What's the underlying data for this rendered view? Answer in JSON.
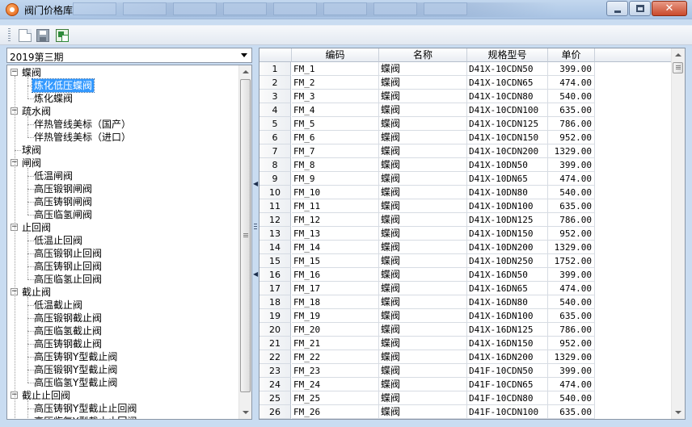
{
  "window": {
    "title": "阀门价格库"
  },
  "period": {
    "selected": "2019第三期"
  },
  "tree": [
    {
      "label": "蝶阀",
      "level": 0,
      "expander": "−"
    },
    {
      "label": "炼化低压蝶阀",
      "level": 1,
      "selected": true
    },
    {
      "label": "炼化蝶阀",
      "level": 1
    },
    {
      "label": "疏水阀",
      "level": 0,
      "expander": "−"
    },
    {
      "label": "伴热管线美标（国产）",
      "level": 1
    },
    {
      "label": "伴热管线美标（进口）",
      "level": 1
    },
    {
      "label": "球阀",
      "level": 0
    },
    {
      "label": "闸阀",
      "level": 0,
      "expander": "−"
    },
    {
      "label": "低温闸阀",
      "level": 1
    },
    {
      "label": "高压锻钢闸阀",
      "level": 1
    },
    {
      "label": "高压铸钢闸阀",
      "level": 1
    },
    {
      "label": "高压临氢闸阀",
      "level": 1
    },
    {
      "label": "止回阀",
      "level": 0,
      "expander": "−"
    },
    {
      "label": "低温止回阀",
      "level": 1
    },
    {
      "label": "高压锻钢止回阀",
      "level": 1
    },
    {
      "label": "高压铸钢止回阀",
      "level": 1
    },
    {
      "label": "高压临氢止回阀",
      "level": 1
    },
    {
      "label": "截止阀",
      "level": 0,
      "expander": "−"
    },
    {
      "label": "低温截止阀",
      "level": 1
    },
    {
      "label": "高压锻钢截止阀",
      "level": 1
    },
    {
      "label": "高压临氢截止阀",
      "level": 1
    },
    {
      "label": "高压铸钢截止阀",
      "level": 1
    },
    {
      "label": "高压铸钢Y型截止阀",
      "level": 1
    },
    {
      "label": "高压锻钢Y型截止阀",
      "level": 1
    },
    {
      "label": "高压临氢Y型截止阀",
      "level": 1
    },
    {
      "label": "截止止回阀",
      "level": 0,
      "expander": "−"
    },
    {
      "label": "高压铸钢Y型截止止回阀",
      "level": 1
    },
    {
      "label": "高压临氢Y型截止止回阀",
      "level": 1
    }
  ],
  "grid": {
    "columns": [
      "编码",
      "名称",
      "规格型号",
      "单价"
    ],
    "rows": [
      {
        "num": "1",
        "code": "FM_1",
        "name": "蝶阀",
        "spec": "D41X-10CDN50",
        "price": "399.00"
      },
      {
        "num": "2",
        "code": "FM_2",
        "name": "蝶阀",
        "spec": "D41X-10CDN65",
        "price": "474.00"
      },
      {
        "num": "3",
        "code": "FM_3",
        "name": "蝶阀",
        "spec": "D41X-10CDN80",
        "price": "540.00"
      },
      {
        "num": "4",
        "code": "FM_4",
        "name": "蝶阀",
        "spec": "D41X-10CDN100",
        "price": "635.00"
      },
      {
        "num": "5",
        "code": "FM_5",
        "name": "蝶阀",
        "spec": "D41X-10CDN125",
        "price": "786.00"
      },
      {
        "num": "6",
        "code": "FM_6",
        "name": "蝶阀",
        "spec": "D41X-10CDN150",
        "price": "952.00"
      },
      {
        "num": "7",
        "code": "FM_7",
        "name": "蝶阀",
        "spec": "D41X-10CDN200",
        "price": "1329.00"
      },
      {
        "num": "8",
        "code": "FM_8",
        "name": "蝶阀",
        "spec": "D41X-10DN50",
        "price": "399.00"
      },
      {
        "num": "9",
        "code": "FM_9",
        "name": "蝶阀",
        "spec": "D41X-10DN65",
        "price": "474.00"
      },
      {
        "num": "10",
        "code": "FM_10",
        "name": "蝶阀",
        "spec": "D41X-10DN80",
        "price": "540.00"
      },
      {
        "num": "11",
        "code": "FM_11",
        "name": "蝶阀",
        "spec": "D41X-10DN100",
        "price": "635.00"
      },
      {
        "num": "12",
        "code": "FM_12",
        "name": "蝶阀",
        "spec": "D41X-10DN125",
        "price": "786.00"
      },
      {
        "num": "13",
        "code": "FM_13",
        "name": "蝶阀",
        "spec": "D41X-10DN150",
        "price": "952.00"
      },
      {
        "num": "14",
        "code": "FM_14",
        "name": "蝶阀",
        "spec": "D41X-10DN200",
        "price": "1329.00"
      },
      {
        "num": "15",
        "code": "FM_15",
        "name": "蝶阀",
        "spec": "D41X-10DN250",
        "price": "1752.00"
      },
      {
        "num": "16",
        "code": "FM_16",
        "name": "蝶阀",
        "spec": "D41X-16DN50",
        "price": "399.00"
      },
      {
        "num": "17",
        "code": "FM_17",
        "name": "蝶阀",
        "spec": "D41X-16DN65",
        "price": "474.00"
      },
      {
        "num": "18",
        "code": "FM_18",
        "name": "蝶阀",
        "spec": "D41X-16DN80",
        "price": "540.00"
      },
      {
        "num": "19",
        "code": "FM_19",
        "name": "蝶阀",
        "spec": "D41X-16DN100",
        "price": "635.00"
      },
      {
        "num": "20",
        "code": "FM_20",
        "name": "蝶阀",
        "spec": "D41X-16DN125",
        "price": "786.00"
      },
      {
        "num": "21",
        "code": "FM_21",
        "name": "蝶阀",
        "spec": "D41X-16DN150",
        "price": "952.00"
      },
      {
        "num": "22",
        "code": "FM_22",
        "name": "蝶阀",
        "spec": "D41X-16DN200",
        "price": "1329.00"
      },
      {
        "num": "23",
        "code": "FM_23",
        "name": "蝶阀",
        "spec": "D41F-10CDN50",
        "price": "399.00"
      },
      {
        "num": "24",
        "code": "FM_24",
        "name": "蝶阀",
        "spec": "D41F-10CDN65",
        "price": "474.00"
      },
      {
        "num": "25",
        "code": "FM_25",
        "name": "蝶阀",
        "spec": "D41F-10CDN80",
        "price": "540.00"
      },
      {
        "num": "26",
        "code": "FM_26",
        "name": "蝶阀",
        "spec": "D41F-10CDN100",
        "price": "635.00"
      }
    ]
  },
  "toolbar": {
    "icons": [
      "new-file-icon",
      "save-icon",
      "export-excel-icon"
    ]
  },
  "colors": {
    "selection": "#3399ff",
    "title_bar": "#b5cde9",
    "close_button": "#c94a2c"
  }
}
